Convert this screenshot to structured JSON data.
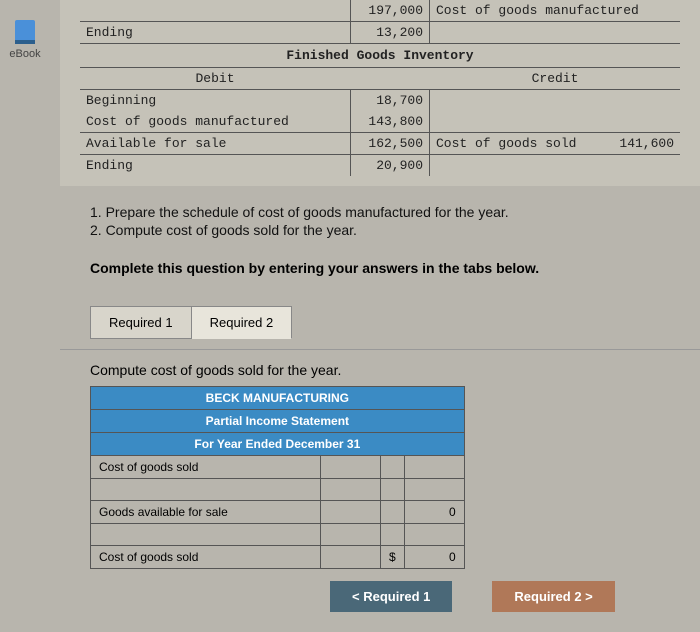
{
  "sidebar": {
    "label": "eBook"
  },
  "ledger": {
    "top_partial_val": "197,000",
    "top_right_label": "Cost of goods manufactured",
    "ending1": "Ending",
    "ending1_val": "13,200",
    "section": "Finished Goods Inventory",
    "col_debit": "Debit",
    "col_credit": "Credit",
    "rows": [
      {
        "label": "Beginning",
        "val": "18,700"
      },
      {
        "label": "Cost of goods manufactured",
        "val": "143,800"
      },
      {
        "label": "Available for sale",
        "val": "162,500"
      }
    ],
    "right_label": "Cost of goods sold",
    "right_val": "141,600",
    "ending2": "Ending",
    "ending2_val": "20,900"
  },
  "instructions": {
    "i1": "1. Prepare the schedule of cost of goods manufactured for the year.",
    "i2": "2. Compute cost of goods sold for the year."
  },
  "complete": "Complete this question by entering your answers in the tabs below.",
  "tabs": {
    "t1": "Required 1",
    "t2": "Required 2"
  },
  "tab_desc": "Compute cost of goods sold for the year.",
  "answer": {
    "h1": "BECK MANUFACTURING",
    "h2": "Partial Income Statement",
    "h3": "For Year Ended December 31",
    "r1": "Cost of goods sold",
    "r2": "Goods available for sale",
    "r2_val": "0",
    "r3": "Cost of goods sold",
    "r3_sym": "$",
    "r3_val": "0"
  },
  "nav": {
    "prev": "<  Required 1",
    "next": "Required 2  >"
  }
}
